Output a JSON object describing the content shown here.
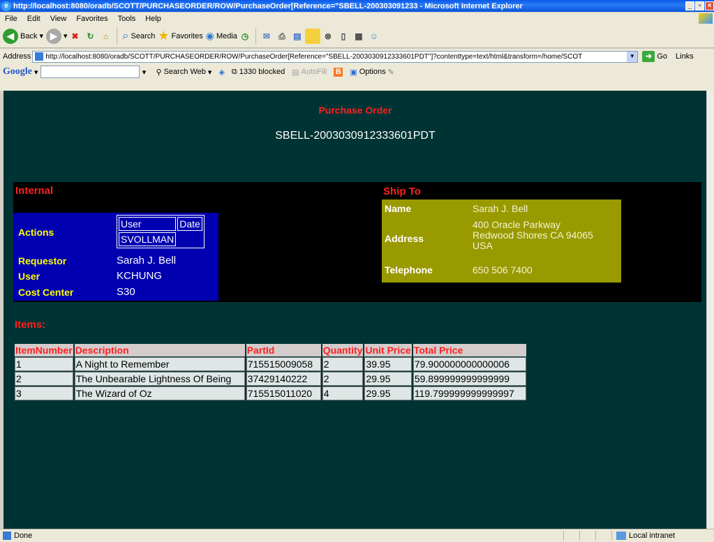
{
  "window": {
    "title": "http://localhost:8080/oradb/SCOTT/PURCHASEORDER/ROW/PurchaseOrder[Reference=\"SBELL-200303091233 - Microsoft Internet Explorer",
    "min": "_",
    "max": "▫",
    "close": "×"
  },
  "menu": [
    "File",
    "Edit",
    "View",
    "Favorites",
    "Tools",
    "Help"
  ],
  "toolbar": {
    "back": "Back",
    "search": "Search",
    "favorites": "Favorites",
    "media": "Media"
  },
  "address": {
    "label": "Address",
    "url": "http://localhost:8080/oradb/SCOTT/PURCHASEORDER/ROW/PurchaseOrder[Reference=\"SBELL-2003030912333601PDT\"]?contenttype=text/html&transform=/home/SCOT",
    "go": "Go",
    "links": "Links"
  },
  "google": {
    "logo": "Google",
    "search_web": "Search Web",
    "blocked": "1330 blocked",
    "autofill": "AutoFill",
    "options": "Options"
  },
  "po": {
    "title": "Purchase Order",
    "reference": "SBELL-2003030912333601PDT",
    "internal_label": "Internal",
    "actions_label": "Actions",
    "actions_headers": [
      "User",
      "Date"
    ],
    "actions_user": "SVOLLMAN",
    "requestor_label": "Requestor",
    "requestor": "Sarah J. Bell",
    "user_label": "User",
    "user": "KCHUNG",
    "cost_center_label": "Cost Center",
    "cost_center": "S30",
    "shipto_label": "Ship To",
    "name_label": "Name",
    "name": "Sarah J. Bell",
    "address_label": "Address",
    "address_line1": "400 Oracle Parkway",
    "address_line2": "Redwood Shores CA 94065",
    "address_line3": "USA",
    "telephone_label": "Telephone",
    "telephone": "650 506 7400",
    "items_label": "Items:"
  },
  "items": {
    "headers": [
      "ItemNumber",
      "Description",
      "PartId",
      "Quantity",
      "Unit Price",
      "Total Price"
    ],
    "rows": [
      [
        "1",
        "A Night to Remember",
        "715515009058",
        "2",
        "39.95",
        "79.900000000000006"
      ],
      [
        "2",
        "The Unbearable Lightness Of Being",
        "37429140222",
        "2",
        "29.95",
        "59.899999999999999"
      ],
      [
        "3",
        "The Wizard of Oz",
        "715515011020",
        "4",
        "29.95",
        "119.799999999999997"
      ]
    ]
  },
  "status": {
    "text": "Done",
    "zone": "Local intranet"
  }
}
